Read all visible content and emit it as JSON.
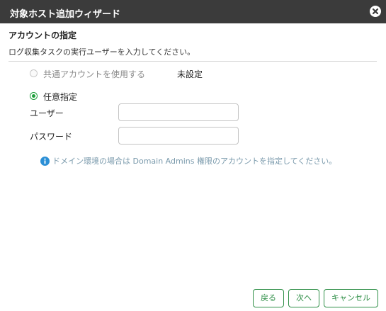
{
  "dialog": {
    "title": "対象ホスト追加ウィザード",
    "close_icon": "close-icon"
  },
  "section": {
    "title": "アカウントの指定",
    "description": "ログ収集タスクの実行ユーザーを入力してください。"
  },
  "account_options": {
    "shared": {
      "label": "共通アカウントを使用する",
      "status": "未設定",
      "checked": false,
      "disabled": true
    },
    "custom": {
      "label": "任意指定",
      "checked": true
    }
  },
  "fields": {
    "user_label": "ユーザー",
    "user_value": "",
    "password_label": "パスワード",
    "password_value": ""
  },
  "info": {
    "icon": "info-icon",
    "text": "ドメイン環境の場合は Domain Admins 権限のアカウントを指定してください。"
  },
  "buttons": {
    "back": "戻る",
    "next": "次へ",
    "cancel": "キャンセル"
  },
  "colors": {
    "titlebar": "#3b3b3b",
    "accent": "#2f8f47",
    "radio_checked": "#1e9e3a",
    "info_icon": "#2b8fd6",
    "info_text": "#7a9aac"
  }
}
